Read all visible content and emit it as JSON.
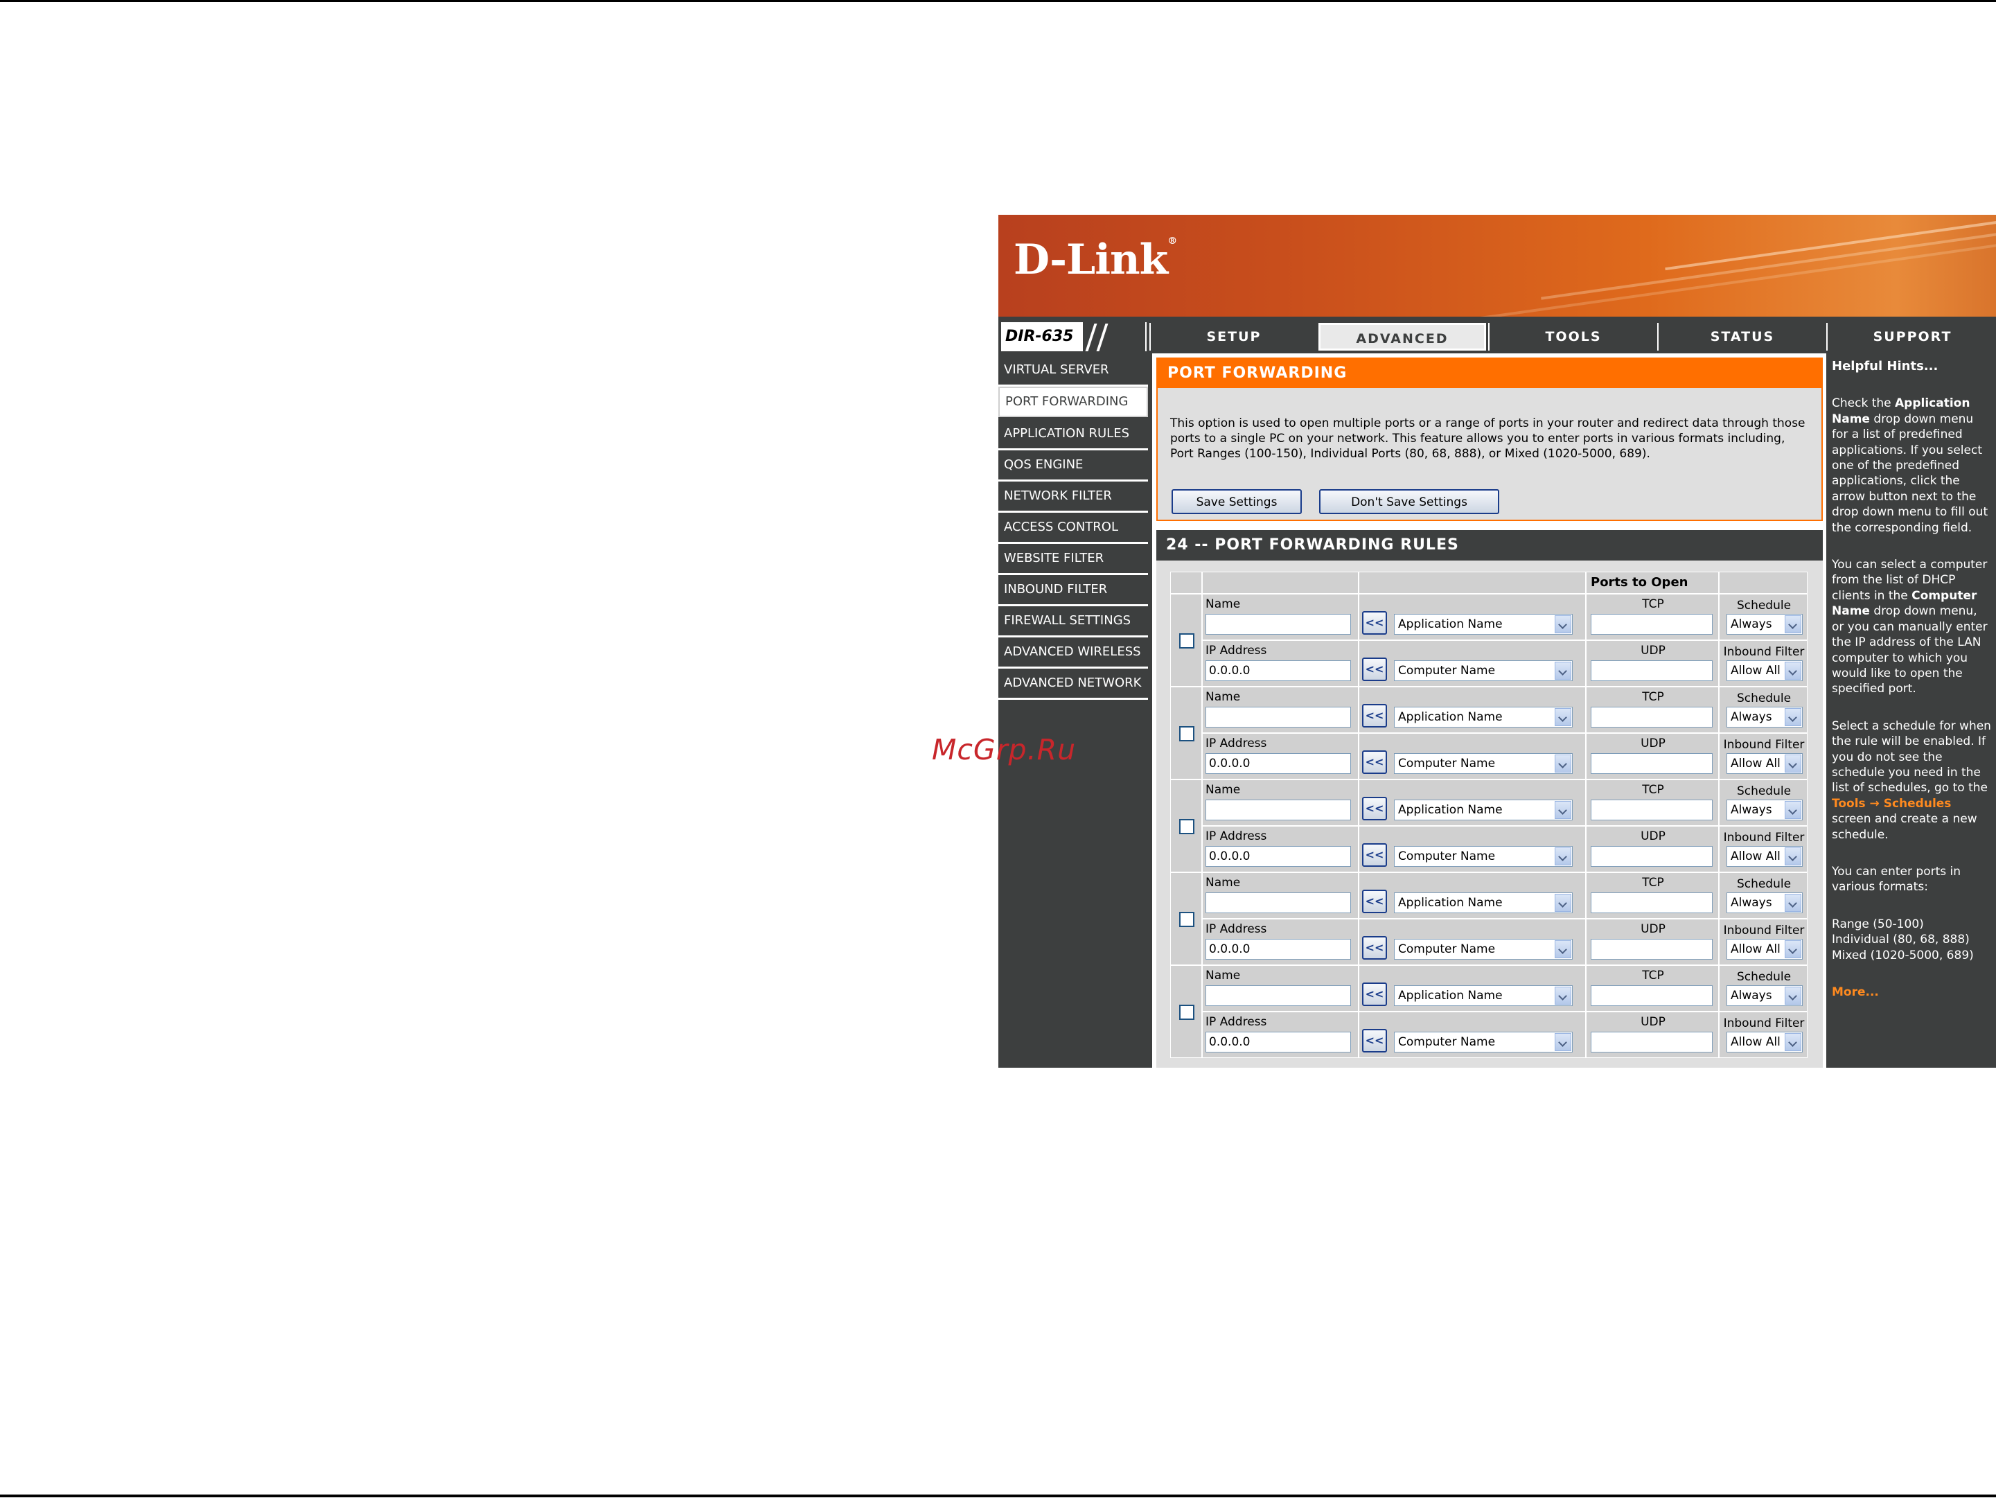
{
  "watermark": "McGrp.Ru",
  "brand": {
    "logo_text": "D-Link",
    "logo_mark": "®",
    "model": "DIR-635"
  },
  "nav_tabs": [
    {
      "label": "SETUP",
      "active": false
    },
    {
      "label": "ADVANCED",
      "active": true
    },
    {
      "label": "TOOLS",
      "active": false
    },
    {
      "label": "STATUS",
      "active": false
    },
    {
      "label": "SUPPORT",
      "active": false
    }
  ],
  "sidebar": {
    "items": [
      {
        "label": "VIRTUAL SERVER",
        "active": false
      },
      {
        "label": "PORT FORWARDING",
        "active": true
      },
      {
        "label": "APPLICATION RULES",
        "active": false
      },
      {
        "label": "QOS ENGINE",
        "active": false
      },
      {
        "label": "NETWORK FILTER",
        "active": false
      },
      {
        "label": "ACCESS CONTROL",
        "active": false
      },
      {
        "label": "WEBSITE FILTER",
        "active": false
      },
      {
        "label": "INBOUND FILTER",
        "active": false
      },
      {
        "label": "FIREWALL SETTINGS",
        "active": false
      },
      {
        "label": "ADVANCED WIRELESS",
        "active": false
      },
      {
        "label": "ADVANCED NETWORK",
        "active": false
      }
    ]
  },
  "port_forwarding": {
    "title": "PORT FORWARDING",
    "description": "This option is used to open multiple ports or a range of ports in your router and redirect data through those ports to a single PC on your network. This feature allows you to enter ports in various formats including, Port Ranges (100-150), Individual Ports (80, 68, 888), or Mixed (1020-5000, 689).",
    "save_label": "Save Settings",
    "dont_save_label": "Don't Save Settings"
  },
  "rules": {
    "title": "24 -- PORT FORWARDING RULES",
    "ports_to_open": "Ports to Open",
    "labels": {
      "name": "Name",
      "ip": "IP Address",
      "tcp": "TCP",
      "udp": "UDP",
      "schedule": "Schedule",
      "inbound": "Inbound Filter",
      "arrow": "<<"
    },
    "rows": [
      {
        "name": "",
        "ip": "0.0.0.0",
        "app": "Application Name",
        "computer": "Computer Name",
        "tcp": "",
        "udp": "",
        "schedule": "Always",
        "inbound": "Allow All"
      },
      {
        "name": "",
        "ip": "0.0.0.0",
        "app": "Application Name",
        "computer": "Computer Name",
        "tcp": "",
        "udp": "",
        "schedule": "Always",
        "inbound": "Allow All"
      },
      {
        "name": "",
        "ip": "0.0.0.0",
        "app": "Application Name",
        "computer": "Computer Name",
        "tcp": "",
        "udp": "",
        "schedule": "Always",
        "inbound": "Allow All"
      },
      {
        "name": "",
        "ip": "0.0.0.0",
        "app": "Application Name",
        "computer": "Computer Name",
        "tcp": "",
        "udp": "",
        "schedule": "Always",
        "inbound": "Allow All"
      },
      {
        "name": "",
        "ip": "0.0.0.0",
        "app": "Application Name",
        "computer": "Computer Name",
        "tcp": "",
        "udp": "",
        "schedule": "Always",
        "inbound": "Allow All"
      }
    ]
  },
  "hints": {
    "title": "Helpful Hints...",
    "p1_a": "Check the ",
    "p1_b": "Application Name",
    "p1_c": " drop down menu for a list of predefined applications. If you select one of the predefined applications, click the arrow button next to the drop down menu to fill out the corresponding field.",
    "p2_a": "You can select a computer from the list of DHCP clients in the ",
    "p2_b": "Computer Name",
    "p2_c": " drop down menu, or you can manually enter the IP address of the LAN computer to which you would like to open the specified port.",
    "p3_a": "Select a schedule for when the rule will be enabled. If you do not see the schedule you need in the list of schedules, go to the ",
    "p3_b": "Tools → Schedules",
    "p3_c": " screen and create a new schedule.",
    "p4": "You can enter ports in various formats:",
    "f1": "Range (50-100)",
    "f2": "Individual (80, 68, 888)",
    "f3": "Mixed (1020-5000, 689)",
    "more": "More..."
  },
  "colors": {
    "accent_orange": "#ff6f00",
    "frame_gray": "#3d3f3f",
    "panel_gray": "#dfdfdf",
    "watermark_red": "#c8262b"
  }
}
